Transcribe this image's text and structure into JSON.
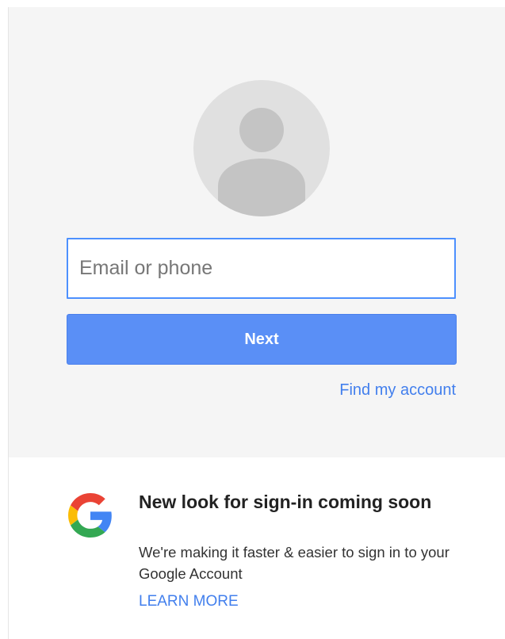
{
  "signin": {
    "email_placeholder": "Email or phone",
    "next_label": "Next",
    "find_account_label": "Find my account"
  },
  "promo": {
    "title": "New look for sign-in coming soon",
    "body": "We're making it faster & easier to sign in to your Google Account",
    "learn_more_label": "LEARN MORE"
  },
  "icons": {
    "avatar": "default-user-avatar-icon",
    "logo": "google-g-logo-icon"
  },
  "colors": {
    "accent_blue": "#4d90fe",
    "button_blue": "#5a8ff6",
    "link_blue": "#427fed",
    "panel_gray": "#f5f5f5",
    "avatar_bg": "#e0e0e0",
    "avatar_fg": "#c4c4c4",
    "google_blue": "#4285f4",
    "google_red": "#ea4335",
    "google_yellow": "#fbbc05",
    "google_green": "#34a853"
  }
}
